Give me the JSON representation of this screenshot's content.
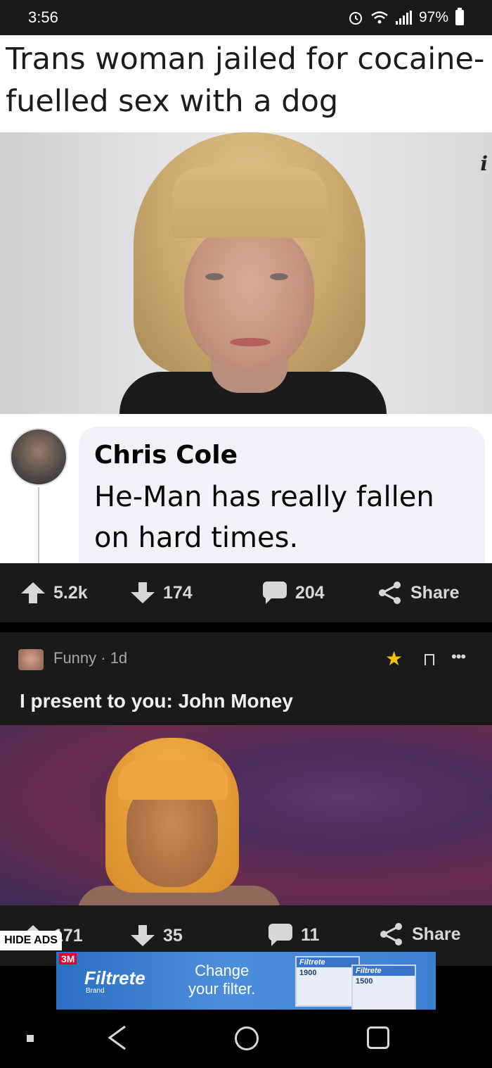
{
  "status_bar": {
    "time": "3:56",
    "battery": "97%",
    "icons": [
      "alarm-icon",
      "wifi-icon",
      "signal-icon",
      "battery-icon"
    ]
  },
  "post1": {
    "headline": "Trans woman jailed for cocaine-fuelled sex with a dog",
    "info_mark": "i",
    "comment": {
      "author": "Chris Cole",
      "text": "He-Man has really fallen on hard times."
    },
    "actions": {
      "upvotes": "5.2k",
      "downvotes": "174",
      "comments": "204",
      "share": "Share"
    }
  },
  "post2": {
    "subreddit_meta": "Funny · 1d",
    "title": "I present to you: John Money",
    "actions": {
      "upvotes": "171",
      "downvotes": "35",
      "comments": "11",
      "share": "Share"
    }
  },
  "hide_ads": "HIDE ADS",
  "ad": {
    "badge": "3M",
    "brand": "Filtrete",
    "brand_sub": "Brand",
    "tagline_line1": "Change",
    "tagline_line2": "your filter.",
    "box1_head": "Filtrete",
    "box1_num": "1900",
    "box2_head": "Filtrete",
    "box2_num": "1500",
    "colors": {
      "background": "#3d7fd0",
      "badge": "#e4002b"
    }
  },
  "colors": {
    "app_background": "#1a1a1b",
    "star": "#f5c400",
    "action_text": "#d7d7d7"
  }
}
